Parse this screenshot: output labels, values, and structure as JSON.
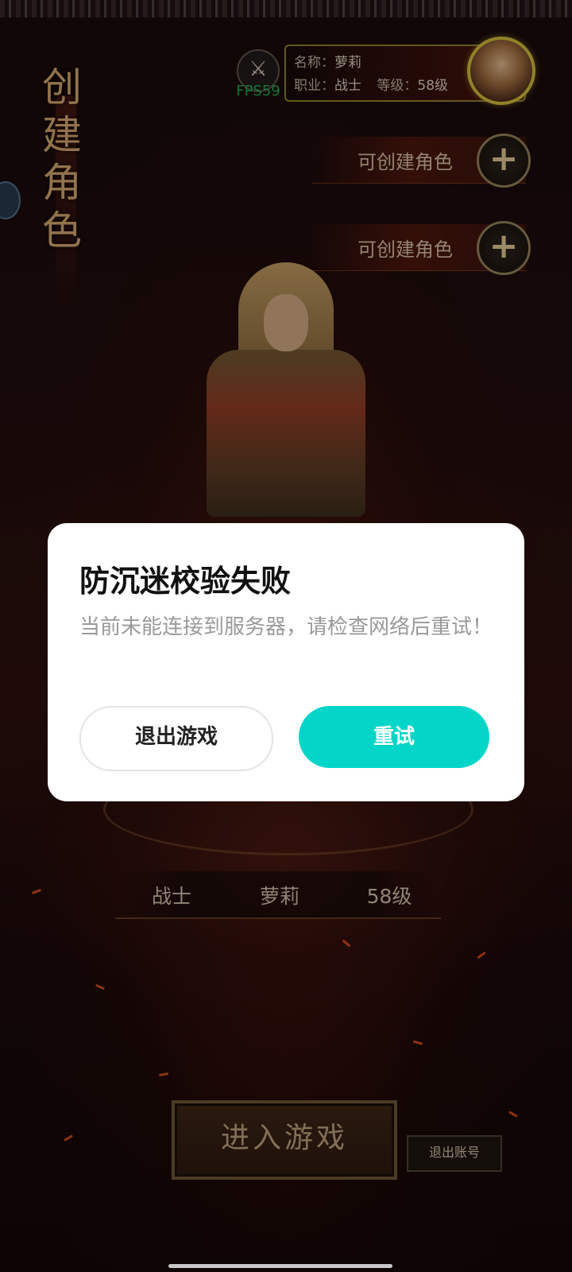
{
  "vertical_title": [
    "创",
    "建",
    "角",
    "色"
  ],
  "hud": {
    "fps": "FPS59",
    "name_label": "名称：",
    "name_value": "萝莉",
    "class_label": "职业：",
    "class_value": "战士",
    "level_label": "等级：",
    "level_value": "58级"
  },
  "slots": [
    {
      "label": "可创建角色"
    },
    {
      "label": "可创建角色"
    }
  ],
  "stats": {
    "class": "战士",
    "name": "萝莉",
    "level": "58级"
  },
  "buttons": {
    "enter_game": "进入游戏",
    "logout": "退出账号"
  },
  "dialog": {
    "title": "防沉迷校验失败",
    "message": "当前未能连接到服务器，请检查网络后重试！",
    "exit_label": "退出游戏",
    "retry_label": "重试"
  },
  "colors": {
    "retry_button": "#04d5c9",
    "dialog_bg": "#ffffff",
    "fps_text": "#1ea34a"
  }
}
